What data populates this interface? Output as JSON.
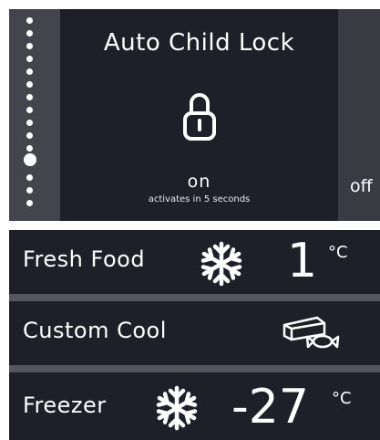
{
  "lock_panel": {
    "title": "Auto Child Lock",
    "state": "on",
    "subtitle": "activates in 5 seconds",
    "next_option": "off",
    "page_total": 13,
    "page_current": 10
  },
  "zones": [
    {
      "label": "Fresh Food",
      "temp": "1",
      "unit": "°C",
      "icon": "snowflake-icon"
    },
    {
      "label": "Custom Cool",
      "icon": "cheese-candy-icon"
    },
    {
      "label": "Freezer",
      "temp": "-27",
      "unit": "°C",
      "icon": "snowflake-icon"
    }
  ],
  "colors": {
    "panel": "#1f1f2a",
    "sidebar": "#44444c",
    "divider": "#55555e",
    "text": "#ffffff"
  }
}
